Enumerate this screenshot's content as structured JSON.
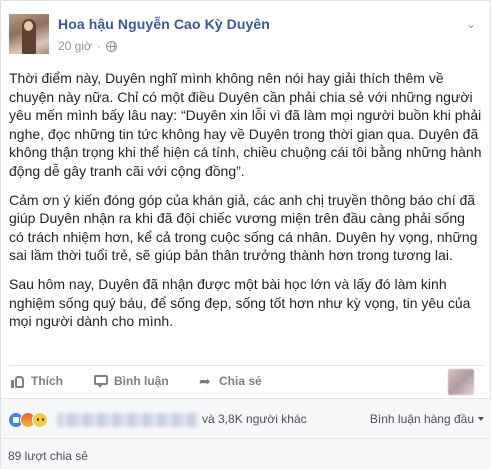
{
  "post": {
    "author": "Hoa hậu Nguyễn Cao Kỳ Duyên",
    "timestamp": "20 giờ",
    "privacy_icon": "globe-icon",
    "menu_icon": "chevron-down-icon",
    "paragraphs": [
      "Thời điểm này, Duyên nghĩ mình không nên nói hay giải thích thêm về chuyện này nữa. Chỉ có một điều Duyên cần phải chia sẻ với những người yêu mến mình bấy lâu nay: “Duyên xin lỗi vì đã làm mọi người buồn khi phải nghe, đọc những tin tức không hay về Duyên trong thời gian qua. Duyên đã không thận trọng khi thể hiện cá tính, chiều chuộng cái tôi bằng những hành động dễ gây tranh cãi với cộng đồng”.",
      "Cảm ơn ý kiến đóng góp của khán giả, các anh chị truyền thông báo chí đã giúp Duyên nhận ra khi đã đội chiếc vương miện trên đầu càng phải sống có trách nhiệm hơn, kể cả trong cuộc sống cá nhân. Duyên hy vọng, những sai lầm thời tuổi trẻ, sẽ giúp bản thân trưởng thành hơn trong tương lai.",
      "Sau hôm nay, Duyên đã nhận được một bài học lớn và lấy đó làm kinh nghiệm sống quý báu, để sống đẹp, sống tốt hơn như kỳ vọng, tin yêu của mọi người dành cho mình."
    ]
  },
  "actions": {
    "like": "Thích",
    "comment": "Bình luận",
    "share": "Chia sẻ"
  },
  "reactions": {
    "icons": [
      "like-reaction-icon",
      "angry-reaction-icon",
      "sad-reaction-icon"
    ],
    "others_text": "và 3,8K người khác",
    "sort_label": "Bình luận hàng đầu"
  },
  "shares": {
    "count_text": "89 lượt chia sẻ"
  },
  "colors": {
    "link_blue": "#365899",
    "meta_gray": "#90949c",
    "action_gray": "#7f7f7f",
    "like_blue": "#4080ff"
  }
}
